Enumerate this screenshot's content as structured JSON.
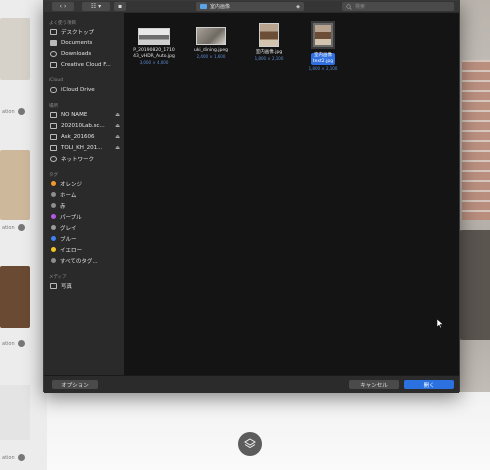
{
  "background": {
    "item_meta": [
      "ation",
      "ation",
      "ation",
      "ation"
    ]
  },
  "toolbar": {
    "nav": "‹ ›",
    "view": "☷ ▾",
    "new_folder": "▪",
    "location": "室内画像",
    "location_chevron": "◆",
    "search_placeholder": "検索"
  },
  "sidebar": {
    "favorites_header": "よく使う項目",
    "favorites": [
      {
        "label": "デスクトップ",
        "icon": "desktop-icon"
      },
      {
        "label": "Documents",
        "icon": "document-icon"
      },
      {
        "label": "Downloads",
        "icon": "download-icon"
      },
      {
        "label": "Creative Cloud F...",
        "icon": "cloud-folder-icon"
      }
    ],
    "icloud_header": "iCloud",
    "icloud": [
      {
        "label": "iCloud Drive",
        "icon": "cloud-icon"
      }
    ],
    "locations_header": "場所",
    "locations": [
      {
        "label": "NO NAME",
        "icon": "drive-icon",
        "eject": "⏏"
      },
      {
        "label": "202010Lab.sc...",
        "icon": "drive-icon",
        "eject": "⏏"
      },
      {
        "label": "Ask_201606",
        "icon": "drive-icon",
        "eject": "⏏"
      },
      {
        "label": "TOLI_KH_201...",
        "icon": "drive-icon",
        "eject": "⏏"
      },
      {
        "label": "ネットワーク",
        "icon": "globe-icon",
        "eject": ""
      }
    ],
    "tags_header": "タグ",
    "tags": [
      {
        "label": "オレンジ",
        "color": "#f0992e"
      },
      {
        "label": "ホーム",
        "color": "#8e8e8e"
      },
      {
        "label": "赤",
        "color": "#8e8e8e"
      },
      {
        "label": "パープル",
        "color": "#b05ae0"
      },
      {
        "label": "グレイ",
        "color": "#9a9a9a"
      },
      {
        "label": "ブルー",
        "color": "#3f82f0"
      },
      {
        "label": "イエロー",
        "color": "#f2c624"
      },
      {
        "label": "すべてのタグ...",
        "color": "#8e8e8e"
      }
    ],
    "media_header": "メディア",
    "media": [
      {
        "label": "写真",
        "icon": "photos-icon"
      }
    ]
  },
  "files": [
    {
      "name": "P_20190820_1710\n43_vHDR_Auto.jpg",
      "size": "3,000 × 4,000",
      "selected": false
    },
    {
      "name": "uki_dining.jpeg",
      "size": "2,400 × 1,600",
      "selected": false
    },
    {
      "name": "室内画像.jpg",
      "size": "1,800 × 2,100",
      "selected": false
    },
    {
      "name": "室内画像\ntext2.jpg",
      "size": "1,800 × 2,100",
      "selected": true
    }
  ],
  "buttons": {
    "options": "オプション",
    "cancel": "キャンセル",
    "open": "開く"
  }
}
